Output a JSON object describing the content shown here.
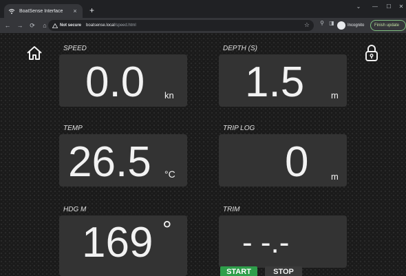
{
  "browser": {
    "tab_title": "BoatSense Interface",
    "tab_close": "×",
    "new_tab": "+",
    "window_controls": {
      "chevron": "⌄",
      "minimize": "—",
      "maximize": "☐",
      "close": "✕"
    },
    "nav": {
      "back": "←",
      "forward": "→",
      "reload": "⟳",
      "home": "⌂"
    },
    "security_label": "Not secure",
    "url_host": "boatsense.local",
    "url_path": "/speed.html",
    "incognito_label": "Incognito",
    "update_button": "Finish update"
  },
  "panels": {
    "speed": {
      "label": "SPEED",
      "value": "0.0",
      "unit": "kn"
    },
    "depth": {
      "label": "DEPTH (S)",
      "value": "1.5",
      "unit": "m"
    },
    "temp": {
      "label": "TEMP",
      "value": "26.5",
      "unit": "°C"
    },
    "trip_log": {
      "label": "TRIP LOG",
      "value": "0",
      "unit": "m"
    },
    "heading": {
      "label": "HDG M",
      "value": "169",
      "unit": "°"
    },
    "trim": {
      "label": "TRIM",
      "value": "- -.-"
    }
  },
  "controls": {
    "start_label": "START",
    "stop_label": "STOP"
  },
  "colors": {
    "panel_bg": "#333333",
    "start_bg": "#2e9e4a",
    "stop_bg": "#3a3a3a"
  }
}
